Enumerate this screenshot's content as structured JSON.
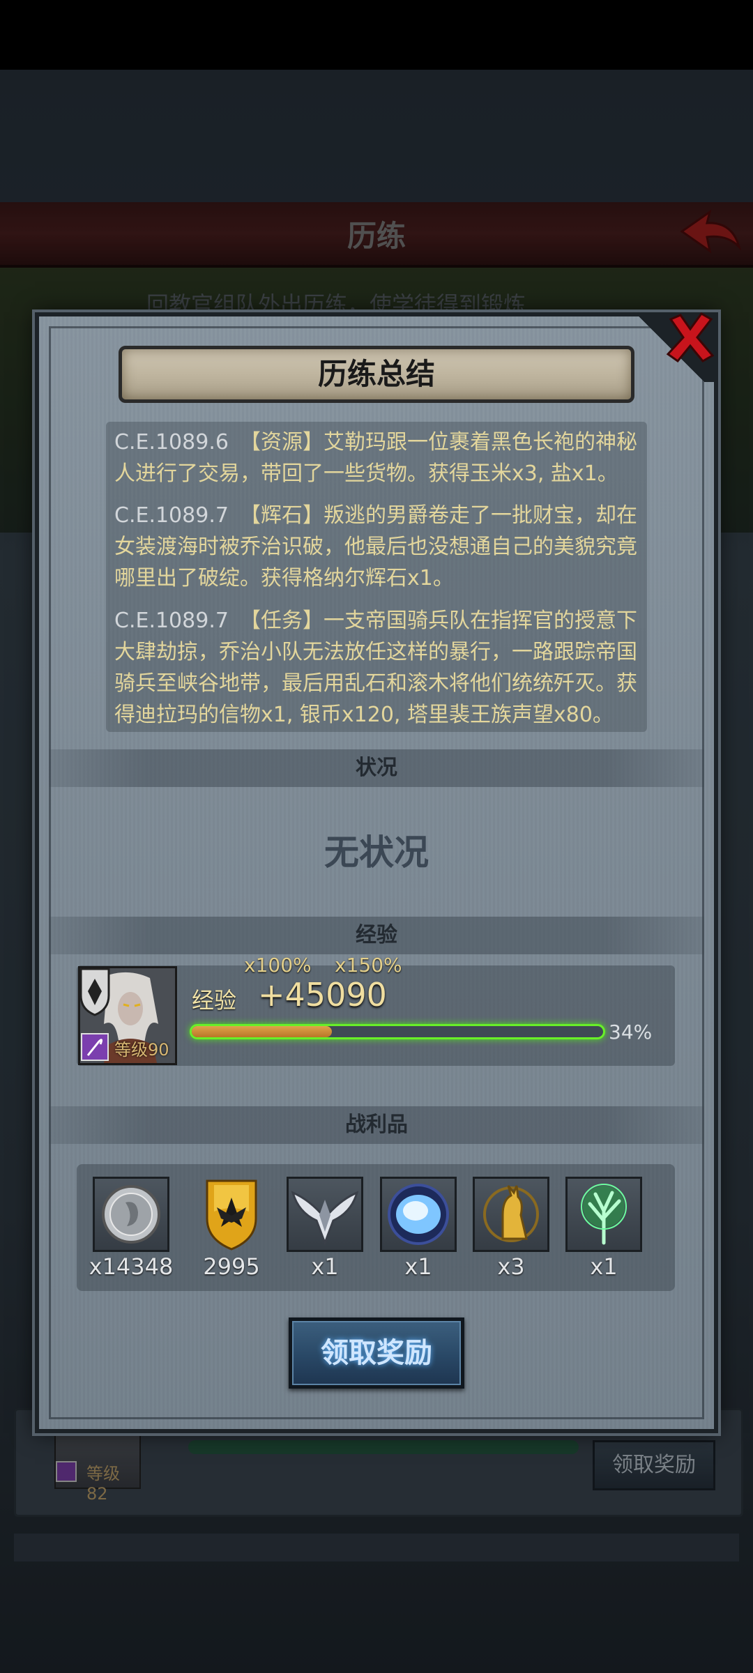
{
  "background": {
    "title": "历练",
    "subtitle": "回教官组队外出历练，使学徒得到锻炼",
    "card": {
      "level": "等级82",
      "claim_label": "领取奖励"
    }
  },
  "dialog": {
    "title": "历练总结",
    "entries": [
      {
        "date": "C.E.1089.6",
        "text": "【资源】艾勒玛跟一位裹着黑色长袍的神秘人进行了交易，带回了一些货物。获得玉米x3, 盐x1。"
      },
      {
        "date": "C.E.1089.7",
        "text": "【辉石】叛逃的男爵卷走了一批财宝，却在女装渡海时被乔治识破，他最后也没想通自己的美貌究竟哪里出了破绽。获得格纳尔辉石x1。"
      },
      {
        "date": "C.E.1089.7",
        "text": "【任务】一支帝国骑兵队在指挥官的授意下大肆劫掠，乔治小队无法放任这样的暴行，一路跟踪帝国骑兵至峡谷地带，最后用乱石和滚木将他们统统歼灭。获得迪拉玛的信物x1, 银币x120, 塔里裴王族声望x80。"
      }
    ],
    "status": {
      "label": "状况",
      "value": "无状况"
    },
    "experience": {
      "section_label": "经验",
      "multiplier_1": "x100%",
      "multiplier_2": "x150%",
      "label": "经验",
      "gain": "+45090",
      "level": "等级90",
      "progress_percent": 34,
      "progress_text": "34%"
    },
    "loot": {
      "section_label": "战利品",
      "items": [
        {
          "icon": "silver-coin-icon",
          "qty": "x14348"
        },
        {
          "icon": "gold-crest-shield-icon",
          "qty": "2995"
        },
        {
          "icon": "winged-emblem-icon",
          "qty": "x1"
        },
        {
          "icon": "blue-crystal-orb-icon",
          "qty": "x1"
        },
        {
          "icon": "golden-cat-statue-icon",
          "qty": "x3"
        },
        {
          "icon": "green-tree-icon",
          "qty": "x1"
        }
      ]
    },
    "claim_label": "领取奖励"
  },
  "colors": {
    "text_gold": "#e3d69c",
    "progress_green": "#68f028",
    "progress_fill": "#d08c3a",
    "claim_button": "#294866",
    "close_red": "#c8141c"
  }
}
